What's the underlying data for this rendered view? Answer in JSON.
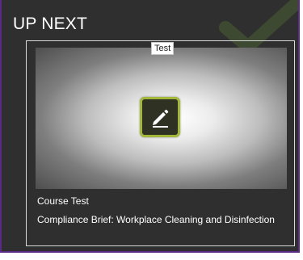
{
  "panel": {
    "title": "UP NEXT",
    "accent_color": "#a3b73a",
    "border_color": "#5b2a86"
  },
  "card": {
    "tag": "Test",
    "icon": "pencil-edit-icon",
    "type_label": "Course Test",
    "course_name": "Compliance Brief: Workplace Cleaning and Disinfection"
  }
}
